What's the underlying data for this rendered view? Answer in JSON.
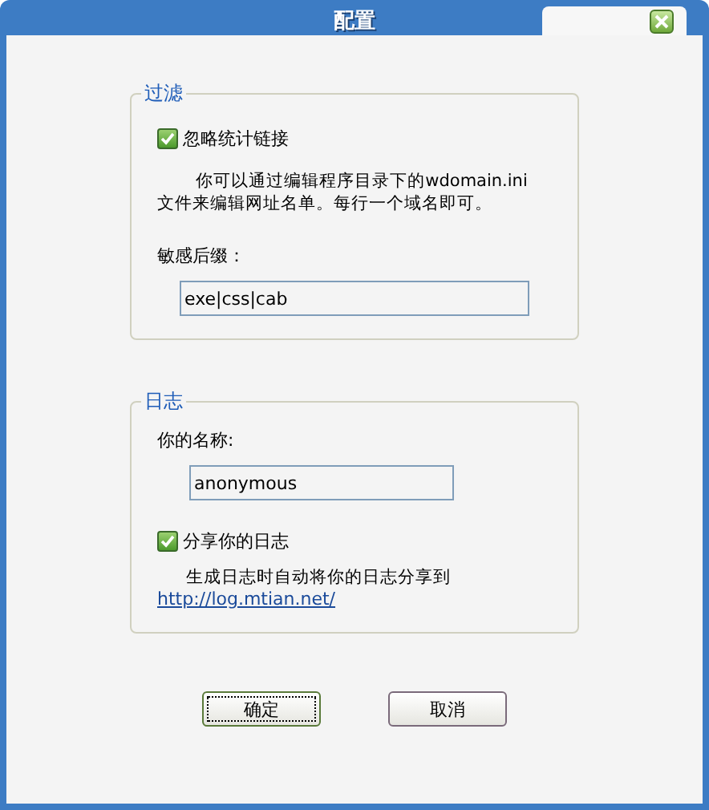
{
  "window": {
    "title": "配置"
  },
  "filter_group": {
    "title": "过滤",
    "ignore_stats_links": {
      "label": "忽略统计链接",
      "checked": true
    },
    "note": "你可以通过编辑程序目录下的wdomain.ini文件来编辑网址名单。每行一个域名即可。",
    "suffix_label": "敏感后缀：",
    "suffix_value": "exe|css|cab"
  },
  "log_group": {
    "title": "日志",
    "name_label": "你的名称:",
    "name_value": "anonymous",
    "share_log": {
      "label": "分享你的日志",
      "checked": true
    },
    "note": "生成日志时自动将你的日志分享到",
    "link": "http://log.mtian.net/"
  },
  "buttons": [
    {
      "label": "确定",
      "default": true
    },
    {
      "label": "取消",
      "default": false
    }
  ]
}
